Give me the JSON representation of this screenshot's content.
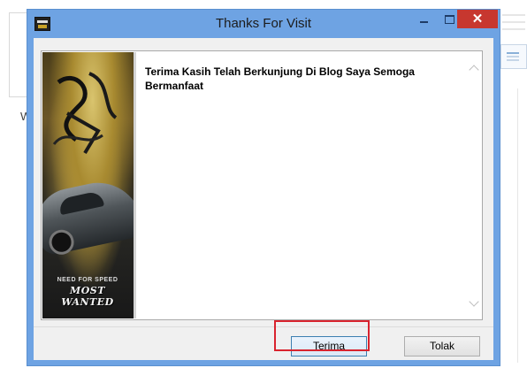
{
  "background": {
    "partial_letter": "W"
  },
  "dialog": {
    "title": "Thanks For Visit",
    "controls": {
      "close_glyph": "✕"
    },
    "message": "Terima Kasih Telah Berkunjung Di Blog Saya Semoga Bermanfaat",
    "image": {
      "logo_line1": "NEED FOR SPEED",
      "logo_line2": "MOST WANTED"
    },
    "buttons": {
      "accept_label": "Terima",
      "reject_label": "Tolak"
    }
  },
  "colors": {
    "window_frame": "#6ea3e3",
    "close_button": "#c7372f",
    "highlight_box": "#d9232e"
  },
  "icons": [
    "app-icon",
    "minimize-icon",
    "maximize-icon",
    "close-icon",
    "scroll-up-icon",
    "scroll-down-icon"
  ]
}
